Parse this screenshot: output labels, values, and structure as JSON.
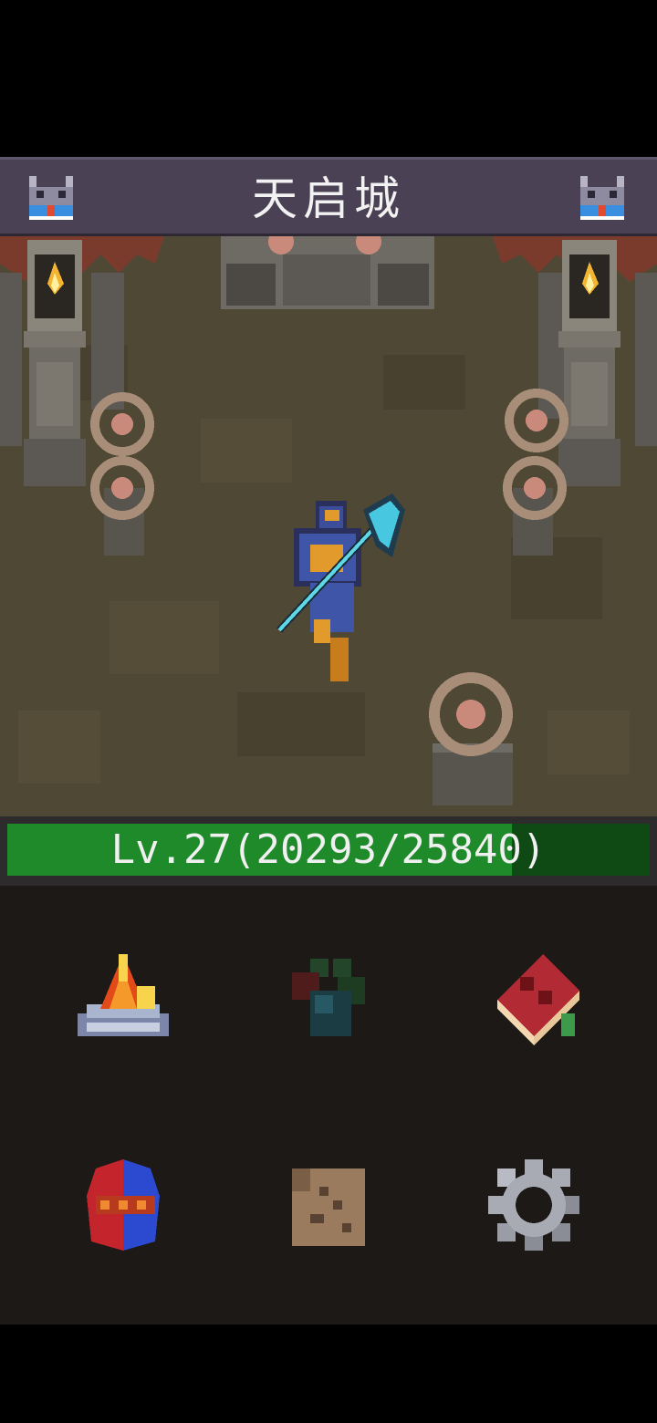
{
  "header": {
    "title": "天启城",
    "left_icon": "castle-icon",
    "right_icon": "castle-icon"
  },
  "player": {
    "level_label": "Lv.27(20293/25840)",
    "level": 27,
    "xp_current": 20293,
    "xp_needed": 25840
  },
  "menu": {
    "items": [
      {
        "icon": "campfire-icon"
      },
      {
        "icon": "potion-bag-icon"
      },
      {
        "icon": "spellbook-icon"
      },
      {
        "icon": "helmet-icon"
      },
      {
        "icon": "map-scroll-icon"
      },
      {
        "icon": "gear-icon"
      }
    ]
  },
  "colors": {
    "title_bar": "#4a4254",
    "xp_fill": "#1e8a2a",
    "xp_empty": "#0f4a14",
    "floor": "#4f4834",
    "menu_bg": "#1c1917"
  }
}
